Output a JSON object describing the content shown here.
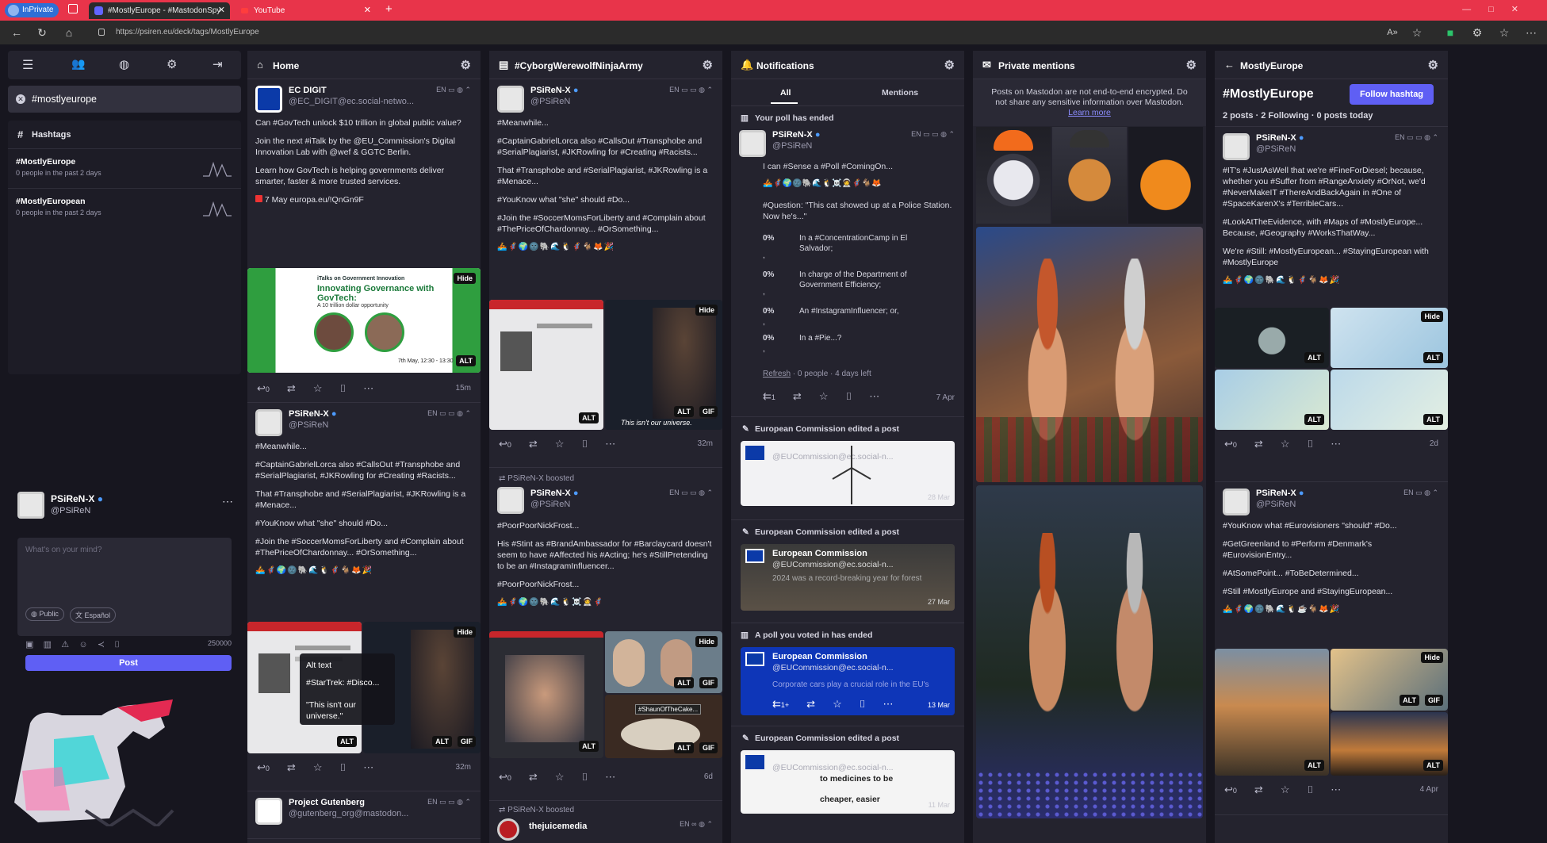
{
  "browser": {
    "profile": "InPrivate",
    "tabs": [
      {
        "label": "#MostlyEurope - #MastodonSpy"
      },
      {
        "label": "YouTube"
      }
    ],
    "url": "https://psiren.eu/deck/tags/MostlyEurope",
    "colors": {
      "accent": "#e8344a",
      "bar": "#2b2b2b"
    }
  },
  "sidebar": {
    "search_tag": "#mostlyeurope",
    "hashtags_title": "Hashtags",
    "hashtags": [
      {
        "name": "#MostlyEurope",
        "sub": "0 people in the past 2 days"
      },
      {
        "name": "#MostlyEuropean",
        "sub": "0 people in the past 2 days"
      }
    ],
    "account": {
      "name": "PSiReN-X",
      "handle": "@PSiReN"
    },
    "compose": {
      "placeholder": "What's on your mind?",
      "visibility": "Public",
      "language": "Español",
      "counter": "250000",
      "post_label": "Post"
    }
  },
  "home": {
    "title": "Home",
    "posts": [
      {
        "name": "EC DIGIT",
        "handle": "@EC_DIGIT@ec.social-netwo...",
        "lang": "EN",
        "time": "15m",
        "text": [
          "Can #GovTech unlock $10 trillion in global public value?",
          "Join the next #iTalk by the @EU_Commission's Digital Innovation Lab with @wef & GGTC Berlin.",
          "Learn how GovTech is helping governments deliver smarter, faster & more trusted services.",
          "7 May europa.eu/!QnGn9F"
        ],
        "image": {
          "title": "Innovating Governance with GovTech:",
          "subtitle": "A 10 trillion dollar opportunity",
          "kicker": "iTalks on Government Innovation",
          "date": "7th May, 12:30 - 13:30"
        }
      },
      {
        "name": "PSiReN-X",
        "handle": "@PSiReN",
        "lang": "EN",
        "time": "32m",
        "text": [
          "#Meanwhile...",
          "#CaptainGabrielLorca also #CallsOut #Transphobe and #SerialPlagiarist, #JKRowling for #Creating #Racists...",
          "That #Transphobe and #SerialPlagiarist, #JKRowling is a #Menace...",
          "#YouKnow what \"she\" should #Do...",
          "#Join the #SoccerMomsForLiberty and #Complain about #ThePriceOfChardonnay... #OrSomething..."
        ],
        "alt": {
          "label": "Alt text",
          "line1": "#StarTrek: #Disco...",
          "line2": "\"This isn't our universe.\""
        }
      },
      {
        "name": "Project Gutenberg",
        "handle": "@gutenberg_org@mastodon...",
        "lang": "EN"
      }
    ]
  },
  "cyborg": {
    "title": "#CyborgWerewolfNinjaArmy",
    "posts": [
      {
        "name": "PSiReN-X",
        "handle": "@PSiReN",
        "lang": "EN",
        "time": "32m",
        "text": [
          "#Meanwhile...",
          "#CaptainGabrielLorca also #CallsOut #Transphobe and #SerialPlagiarist, #JKRowling for #Creating #Racists...",
          "That #Transphobe and #SerialPlagiarist, #JKRowling is a #Menace...",
          "#YouKnow what \"she\" should #Do...",
          "#Join the #SoccerMomsForLiberty and #Complain about #ThePriceOfChardonnay... #OrSomething..."
        ],
        "caption": "This isn't our universe."
      },
      {
        "boost": "PSiReN-X boosted",
        "name": "PSiReN-X",
        "handle": "@PSiReN",
        "lang": "EN",
        "time": "6d",
        "text": [
          "#PoorPoorNickFrost...",
          "His #Stint as #BrandAmbassador for #Barclaycard doesn't seem to have #Affected his #Acting; he's #StillPretending to be an #InstagramInfluencer...",
          "#PoorPoorNickFrost..."
        ],
        "caption": "#ShaunOfTheCake..."
      },
      {
        "boost": "PSiReN-X boosted",
        "name": "thejuicemedia",
        "lang": "EN"
      }
    ]
  },
  "notifications": {
    "title": "Notifications",
    "tabs": [
      "All",
      "Mentions"
    ],
    "poll_ended": "Your poll has ended",
    "poll_post": {
      "name": "PSiReN-X",
      "handle": "@PSiReN",
      "lang": "EN",
      "time": "7 Apr",
      "text": "I can #Sense a #Poll #ComingOn...",
      "question": "#Question: \"This cat showed up at a Police Station. Now he's...\"",
      "options": [
        {
          "pct": "0%",
          "text": "In a #ConcentrationCamp in El Salvador;"
        },
        {
          "pct": "0%",
          "text": "In charge of the Department of Government Efficiency;"
        },
        {
          "pct": "0%",
          "text": "An #InstagramInfluencer; or,"
        },
        {
          "pct": "0%",
          "text": "In a #Pie...?"
        }
      ],
      "footer_refresh": "Refresh",
      "footer_rest": " · 0 people · 4 days left",
      "reply_count": "1"
    },
    "edited": "European Commission edited a post",
    "voted": "A poll you voted in has ended",
    "ec_cards": [
      {
        "handle": "@EUCommission@ec.social-n...",
        "date": "28 Mar"
      },
      {
        "name": "European Commission",
        "handle": "@EUCommission@ec.social-n...",
        "line": "2024 was a record-breaking year for forest",
        "date": "27 Mar"
      },
      {
        "name": "European Commission",
        "handle": "@EUCommission@ec.social-n...",
        "line": "Corporate cars play a crucial role in the EU's",
        "date": "13 Mar",
        "reply_count": "1+"
      },
      {
        "handle": "@EUCommission@ec.social-n...",
        "line": "to medicines to be",
        "line2": "cheaper, easier",
        "date": "11 Mar"
      }
    ]
  },
  "private": {
    "title": "Private mentions",
    "notice": "Posts on Mastodon are not end-to-end encrypted. Do not share any sensitive information over Mastodon.",
    "learn_more": "Learn more"
  },
  "mostly": {
    "title": "MostlyEurope",
    "tag": "#MostlyEurope",
    "follow": "Follow hashtag",
    "stats": "2 posts · 2 Following · 0 posts today",
    "posts": [
      {
        "name": "PSiReN-X",
        "handle": "@PSiReN",
        "lang": "EN",
        "time": "2d",
        "text": [
          "#IT's #JustAsWell that we're #FineForDiesel; because, whether you #Suffer from #RangeAnxiety #OrNot, we'd #NeverMakeIT #ThereAndBackAgain in #One of #SpaceKarenX's #TerribleCars...",
          "#LookAtTheEvidence, with #Maps of #MostlyEurope... Because, #Geography #WorksThatWay...",
          "We're #Still: #MostlyEuropean... #StayingEuropean with #MostlyEurope"
        ]
      },
      {
        "name": "PSiReN-X",
        "handle": "@PSiReN",
        "lang": "EN",
        "time": "4 Apr",
        "text": [
          "#YouKnow what #Eurovisioners \"should\" #Do...",
          "#GetGreenland to #Perform #Denmark's #EurovisionEntry...",
          "#AtSomePoint... #ToBeDetermined...",
          "#Still #MostlyEurope and #StayingEuropean..."
        ]
      }
    ]
  },
  "labels": {
    "hide": "Hide",
    "alt": "ALT",
    "gif": "GIF",
    "zero": "0"
  }
}
